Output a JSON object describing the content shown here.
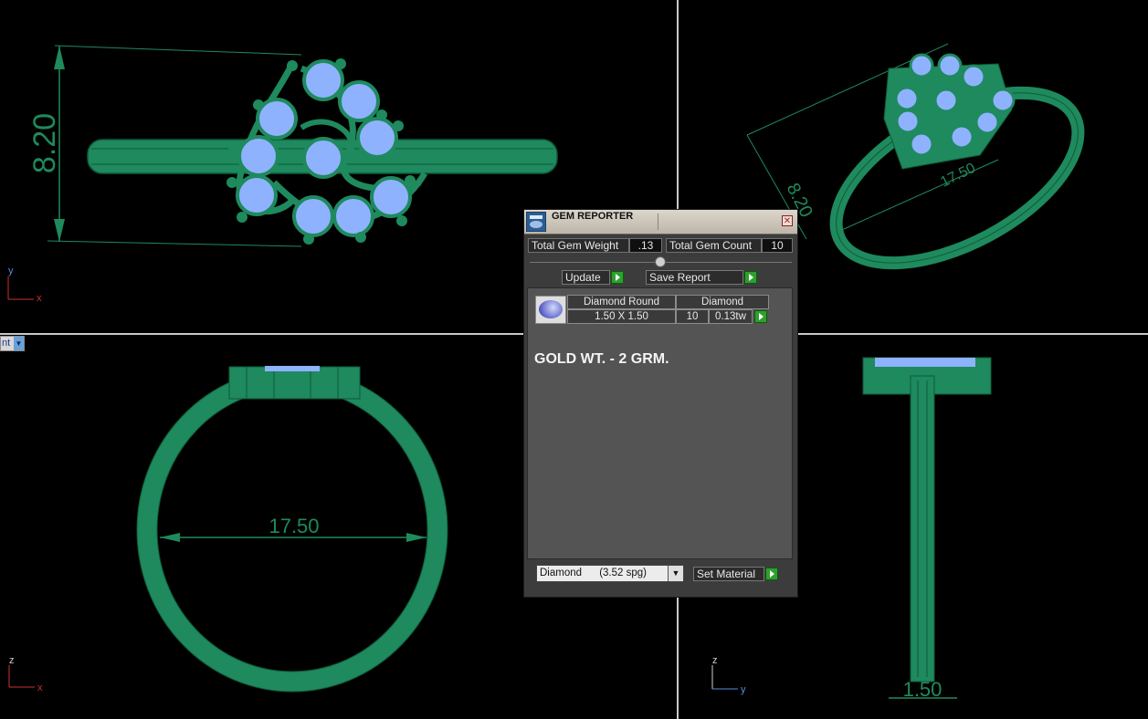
{
  "viewports": {
    "top_left": {
      "dimension": "8.20",
      "axis_h": "x",
      "axis_v": "y"
    },
    "top_right": {
      "dimension_a": "8.20",
      "dimension_b": "17.50"
    },
    "bottom_left": {
      "dimension": "17.50",
      "axis_h": "x",
      "axis_v": "z",
      "view_menu_text": "nt"
    },
    "bottom_right": {
      "dimension": "1.50",
      "axis_h": "y",
      "axis_v": "z"
    }
  },
  "gem_reporter": {
    "title": "GEM REPORTER",
    "total_weight_label": "Total Gem Weight",
    "total_weight_value": ".13",
    "total_count_label": "Total Gem Count",
    "total_count_value": "10",
    "update_label": "Update",
    "save_report_label": "Save Report",
    "gem_row": {
      "shape": "Diamond Round",
      "material": "Diamond",
      "size": "1.50 X 1.50",
      "count": "10",
      "weight": "0.13tw"
    },
    "note": "GOLD WT. - 2 GRM.",
    "material_select": "Diamond      (3.52 spg)",
    "set_material_label": "Set Material"
  },
  "colors": {
    "model": "#1e8a5e",
    "gem": "#8fb2ff",
    "dimension": "#1f8a5c",
    "background": "#000000"
  }
}
